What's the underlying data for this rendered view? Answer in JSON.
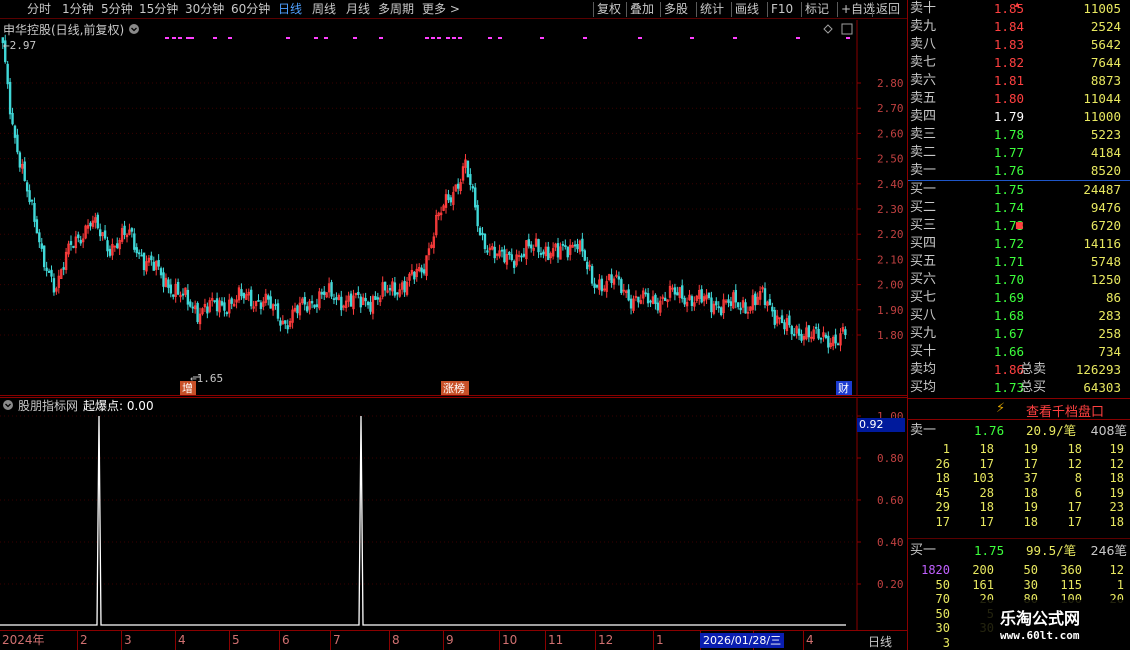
{
  "toolbar": {
    "left_items": [
      "分时",
      "1分钟",
      "5分钟",
      "15分钟",
      "30分钟",
      "60分钟",
      "日线",
      "周线",
      "月线",
      "多周期",
      "更多 >"
    ],
    "active_item": "日线",
    "right_items": [
      "复权",
      "叠加",
      "多股",
      "统计",
      "画线",
      "F10",
      "标记",
      "+自选",
      "返回"
    ]
  },
  "stock": {
    "title": "申华控股(日线,前复权)",
    "high_label": "2.97",
    "low_label": "1.65"
  },
  "price_axis": {
    "ticks": [
      "2.80",
      "2.70",
      "2.60",
      "2.50",
      "2.40",
      "2.30",
      "2.20",
      "2.10",
      "2.00",
      "1.90",
      "1.80"
    ]
  },
  "markers": [
    {
      "text": "增",
      "color": "#c85028"
    },
    {
      "text": "涨榜",
      "color": "#c85028"
    },
    {
      "text": "财",
      "color": "#1c3cd0"
    }
  ],
  "indicator": {
    "title": "股朋指标网",
    "subtitle": "起爆点: 0.00",
    "axis": [
      "1.00",
      "0.80",
      "0.60",
      "0.40",
      "0.20"
    ],
    "current_value": "0.92"
  },
  "timeline": {
    "labels": [
      "2024年",
      "2",
      "3",
      "4",
      "5",
      "6",
      "7",
      "8",
      "9",
      "10",
      "11",
      "12",
      "1",
      "2",
      "3",
      "4"
    ],
    "cursor_date": "2026/01/28/三",
    "period": "日线"
  },
  "order_book": {
    "asks": [
      {
        "label": "卖十",
        "price": "1.85",
        "vol": "11005",
        "color": "#ff4040"
      },
      {
        "label": "卖九",
        "price": "1.84",
        "vol": "2524",
        "color": "#ff4040"
      },
      {
        "label": "卖八",
        "price": "1.83",
        "vol": "5642",
        "color": "#ff4040"
      },
      {
        "label": "卖七",
        "price": "1.82",
        "vol": "7644",
        "color": "#ff4040"
      },
      {
        "label": "卖六",
        "price": "1.81",
        "vol": "8873",
        "color": "#ff4040"
      },
      {
        "label": "卖五",
        "price": "1.80",
        "vol": "11044",
        "color": "#ff4040"
      },
      {
        "label": "卖四",
        "price": "1.79",
        "vol": "11000",
        "color": "#ffffff"
      },
      {
        "label": "卖三",
        "price": "1.78",
        "vol": "5223",
        "color": "#3cff3c"
      },
      {
        "label": "卖二",
        "price": "1.77",
        "vol": "4184",
        "color": "#3cff3c"
      },
      {
        "label": "卖一",
        "price": "1.76",
        "vol": "8520",
        "color": "#3cff3c"
      }
    ],
    "bids": [
      {
        "label": "买一",
        "price": "1.75",
        "vol": "24487",
        "color": "#3cff3c"
      },
      {
        "label": "买二",
        "price": "1.74",
        "vol": "9476",
        "color": "#3cff3c"
      },
      {
        "label": "买三",
        "price": "1.73",
        "vol": "6720",
        "color": "#3cff3c"
      },
      {
        "label": "买四",
        "price": "1.72",
        "vol": "14116",
        "color": "#3cff3c"
      },
      {
        "label": "买五",
        "price": "1.71",
        "vol": "5748",
        "color": "#3cff3c"
      },
      {
        "label": "买六",
        "price": "1.70",
        "vol": "1250",
        "color": "#3cff3c"
      },
      {
        "label": "买七",
        "price": "1.69",
        "vol": "86",
        "color": "#3cff3c"
      },
      {
        "label": "买八",
        "price": "1.68",
        "vol": "283",
        "color": "#3cff3c"
      },
      {
        "label": "买九",
        "price": "1.67",
        "vol": "258",
        "color": "#3cff3c"
      },
      {
        "label": "买十",
        "price": "1.66",
        "vol": "734",
        "color": "#3cff3c"
      }
    ],
    "avg_sell": {
      "label": "卖均",
      "price": "1.86",
      "total_label": "总卖",
      "total": "126293"
    },
    "avg_buy": {
      "label": "买均",
      "price": "1.73",
      "total_label": "总买",
      "total": "64303"
    }
  },
  "thousand_button": "查看千档盘口",
  "sell_queue": {
    "label": "卖一",
    "price": "1.76",
    "avg": "20.9/笔",
    "count": "408笔",
    "rows": [
      [
        "1",
        "18",
        "19",
        "18",
        "19"
      ],
      [
        "26",
        "17",
        "17",
        "12",
        "12"
      ],
      [
        "18",
        "103",
        "37",
        "8",
        "18"
      ],
      [
        "45",
        "28",
        "18",
        "6",
        "19"
      ],
      [
        "29",
        "18",
        "19",
        "17",
        "23"
      ],
      [
        "17",
        "17",
        "18",
        "17",
        "18"
      ]
    ]
  },
  "buy_queue": {
    "label": "买一",
    "price": "1.75",
    "avg": "99.5/笔",
    "count": "246笔",
    "rows": [
      [
        "1820",
        "200",
        "50",
        "360",
        "12"
      ],
      [
        "50",
        "161",
        "30",
        "115",
        "1"
      ],
      [
        "70",
        "20",
        "80",
        "100",
        "20"
      ],
      [
        "50",
        "5",
        "",
        "",
        ""
      ],
      [
        "30",
        "30",
        "",
        "",
        ""
      ],
      [
        "3",
        "",
        "",
        "",
        ""
      ]
    ]
  },
  "watermark": {
    "title": "乐淘公式网",
    "url": "www.60lt.com"
  }
}
